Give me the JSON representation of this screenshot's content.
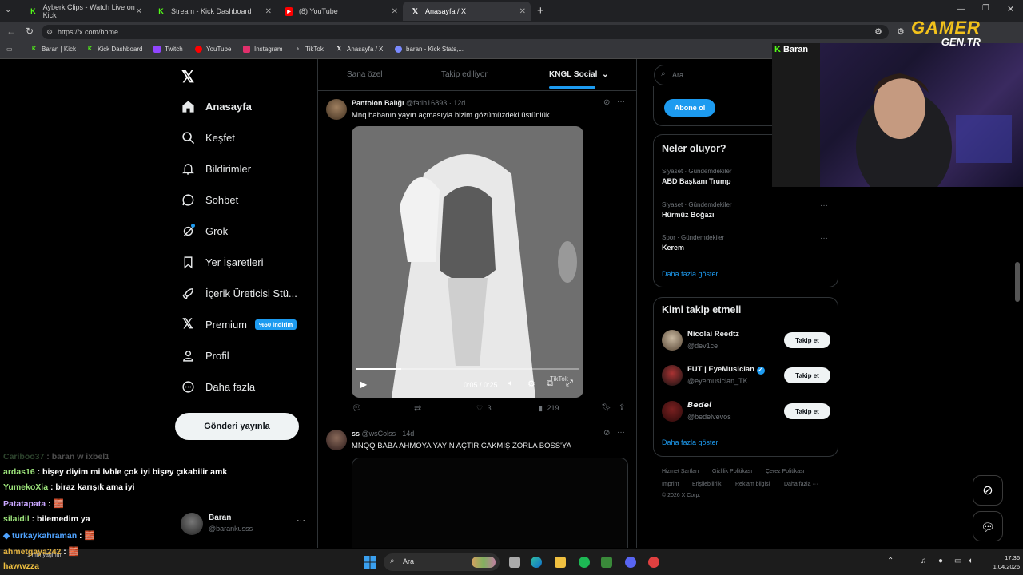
{
  "browser": {
    "tabs": [
      {
        "label": "Ayberk Clips - Watch Live on Kick",
        "icon": "kick-icon"
      },
      {
        "label": "Stream - Kick Dashboard",
        "icon": "kick-icon"
      },
      {
        "label": "(8) YouTube",
        "icon": "youtube-icon"
      },
      {
        "label": "Anasayfa / X",
        "icon": "x-icon"
      }
    ],
    "url": "https://x.com/home",
    "bookmarks": [
      "Baran | Kick",
      "Kick Dashboard",
      "Twitch",
      "YouTube",
      "Instagram",
      "TikTok",
      "Anasayfa / X",
      "baran - Kick Stats,..."
    ]
  },
  "sidebar": {
    "items": [
      {
        "label": "Anasayfa"
      },
      {
        "label": "Keşfet"
      },
      {
        "label": "Bildirimler"
      },
      {
        "label": "Sohbet"
      },
      {
        "label": "Grok"
      },
      {
        "label": "Yer İşaretleri"
      },
      {
        "label": "İçerik Üreticisi Stü..."
      },
      {
        "label": "Premium",
        "badge": "%50 indirim"
      },
      {
        "label": "Profil"
      },
      {
        "label": "Daha fazla"
      }
    ],
    "post_button": "Gönderi yayınla",
    "account": {
      "name": "Baran",
      "handle": "@barankusss"
    }
  },
  "feed": {
    "tabs": [
      "Sana özel",
      "Takip ediliyor",
      "KNGL Social"
    ],
    "tweets": [
      {
        "name": "Pantolon Balığı",
        "handle": "@fatih16893",
        "time": "12d",
        "text": "Mnq babanın yayın açmasıyla bizim gözümüzdeki üstünlük",
        "video_time": "0:05 / 0:25",
        "video_watermark": "TikTok",
        "stats": {
          "replies": "",
          "reposts": "",
          "likes": "3",
          "views": "219"
        }
      },
      {
        "name": "ss",
        "handle": "@wsColss",
        "time": "14d",
        "text": "MNQQ BABA AHMOYA YAYIN AÇTIRICAKMIŞ ZORLA BOSS'YA"
      }
    ]
  },
  "right": {
    "search_placeholder": "Ara",
    "subscribe_button": "Abone ol",
    "trends_title": "Neler oluyor?",
    "trends": [
      {
        "category": "Siyaset · Gündemdekiler",
        "name": "ABD Başkanı Trump"
      },
      {
        "category": "Siyaset · Gündemdekiler",
        "name": "Hürmüz Boğazı"
      },
      {
        "category": "Spor · Gündemdekiler",
        "name": "Kerem"
      }
    ],
    "trends_more": "Daha fazla göster",
    "who_to_follow_title": "Kimi takip etmeli",
    "suggestions": [
      {
        "name": "Nicolai Reedtz",
        "handle": "@dev1ce",
        "verified": false
      },
      {
        "name": "FUT | EyeMusician",
        "handle": "@eyemusician_TK",
        "verified": true
      },
      {
        "name": "𝘽𝙚𝙙𝙚𝙡",
        "handle": "@bedelvevos",
        "verified": false
      }
    ],
    "follow_label": "Takip et",
    "follow_more": "Daha fazla göster",
    "footer": [
      "Hizmet Şartları",
      "Gizlilik Politikası",
      "Çerez Politikası",
      "Imprint",
      "Erişilebilirlik",
      "Reklam bilgisi",
      "Daha fazla ···",
      "© 2026 X Corp."
    ]
  },
  "overlay": {
    "watermark_line1": "GAMER",
    "watermark_line2": "GEN.TR",
    "streamer_label": "Baran",
    "chat": [
      {
        "user": "Cariboo37",
        "text": "baran w ixbel1",
        "color": "#5f8f5f"
      },
      {
        "user": "ardas16",
        "text": "bişey diyim mi lvble çok iyi bişey çıkabilir amk",
        "color": "#9be27a"
      },
      {
        "user": "YumekoXia",
        "text": "biraz karışık ama iyi",
        "color": "#9be27a"
      },
      {
        "user": "Patatapata",
        "text": "🧱",
        "color": "#c9a6ff"
      },
      {
        "user": "silaidil",
        "text": "bilemedim ya",
        "color": "#9be27a"
      },
      {
        "user": "turkaykahraman",
        "text": "🧱",
        "color": "#4fa3ff"
      },
      {
        "user": "ahmetgaya242",
        "text": "🧱",
        "color": "#e0b040"
      },
      {
        "user": "hawwzza",
        "text": "",
        "color": "#f0c040"
      }
    ]
  },
  "taskbar": {
    "search": "Ara",
    "weather": "1 mm yağmur",
    "time": "17:36",
    "date": "1.04.2026"
  }
}
